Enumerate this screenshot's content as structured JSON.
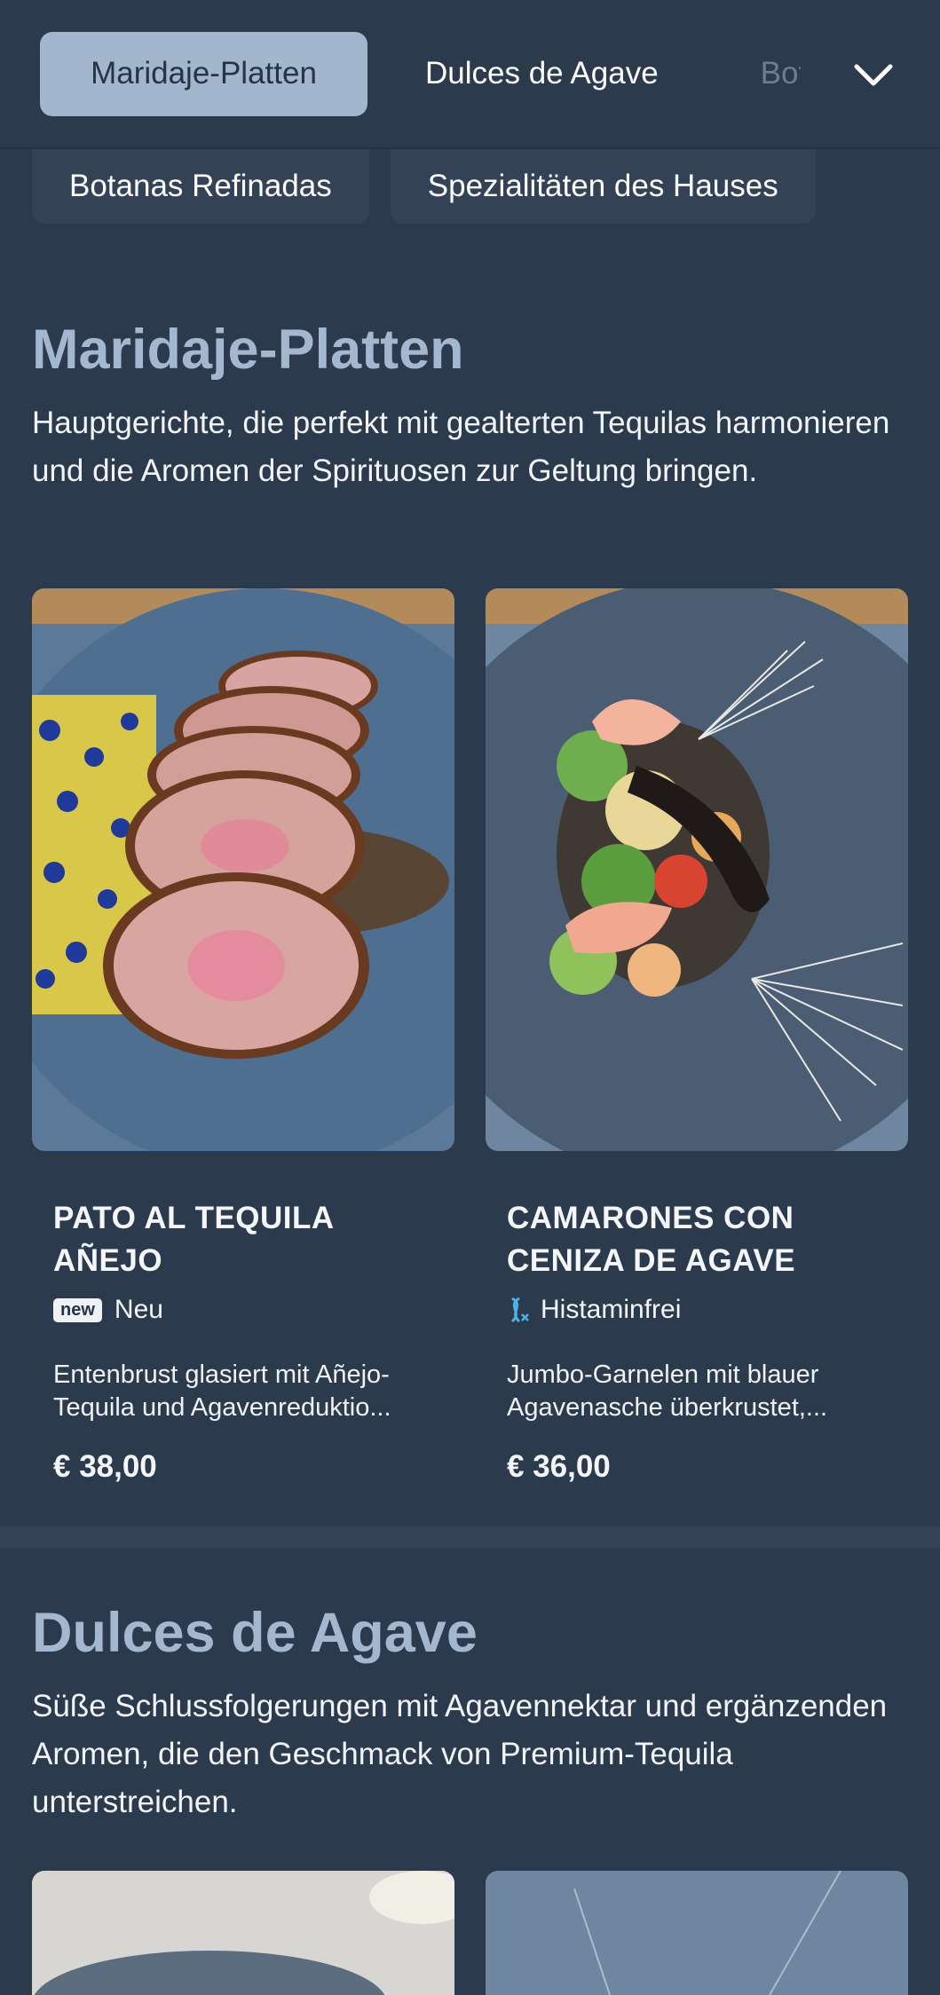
{
  "nav": {
    "tabs": [
      {
        "label": "Maridaje-Platten"
      },
      {
        "label": "Dulces de Agave"
      },
      {
        "label": "Bot"
      }
    ],
    "chips": [
      {
        "label": "Botanas Refinadas"
      },
      {
        "label": "Spezialitäten des Hauses"
      }
    ],
    "expand_icon": "chevron-down-icon"
  },
  "sections": [
    {
      "title": "Maridaje-Platten",
      "description": "Hauptgerichte, die perfekt mit gealterten Tequilas harmonieren und die Aromen der Spirituosen zur Geltung bringen.",
      "items": [
        {
          "name": "PATO AL TEQUILA AÑEJO",
          "badge": "new",
          "tag": "Neu",
          "description": "Entenbrust glasiert mit Añejo-Tequila und Agavenreduktio...",
          "price": "€ 38,00"
        },
        {
          "name": "CAMARONES CON CENIZA DE AGAVE",
          "tag_icon": "dna-icon",
          "tag": "Histaminfrei",
          "description": "Jumbo-Garnelen mit blauer Agavenasche überkrustet,...",
          "price": "€ 36,00"
        }
      ]
    },
    {
      "title": "Dulces de Agave",
      "description": "Süße Schlussfolgerungen mit Agavennektar und ergänzenden Aromen, die den Geschmack von Premium-Tequila unterstreichen."
    }
  ],
  "colors": {
    "background": "#2c3a4d",
    "accent": "#a2b6ce",
    "title": "#a3b7cf",
    "tag_icon": "#4fb3e8"
  }
}
